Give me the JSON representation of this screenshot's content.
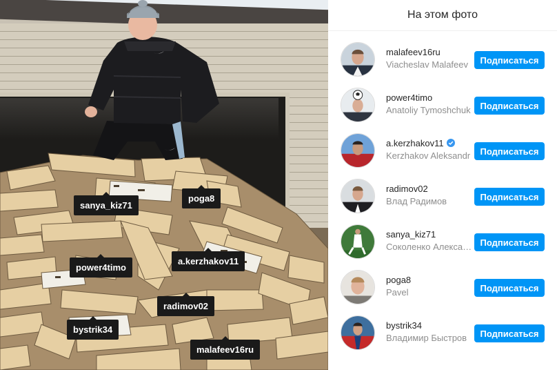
{
  "panel": {
    "title": "На этом фото",
    "accent_color": "#0095f6",
    "people": [
      {
        "username": "malafeev16ru",
        "full_name": "Viacheslav Malafeev",
        "verified": false,
        "button": "Подписаться"
      },
      {
        "username": "power4timo",
        "full_name": "Anatoliy Tymoshchuk",
        "verified": false,
        "button": "Подписаться"
      },
      {
        "username": "a.kerzhakov11",
        "full_name": "Kerzhakov Aleksandr",
        "verified": true,
        "button": "Подписаться"
      },
      {
        "username": "radimov02",
        "full_name": "Влад Радимов",
        "verified": false,
        "button": "Подписаться"
      },
      {
        "username": "sanya_kiz71",
        "full_name": "Соколенко Алекса…",
        "verified": false,
        "button": "Подписаться"
      },
      {
        "username": "poga8",
        "full_name": "Pavel",
        "verified": false,
        "button": "Подписаться"
      },
      {
        "username": "bystrik34",
        "full_name": "Владимир Быстров",
        "verified": false,
        "button": "Подписаться"
      }
    ]
  },
  "photo_tags": [
    {
      "label": "sanya_kiz71"
    },
    {
      "label": "poga8"
    },
    {
      "label": "power4timo"
    },
    {
      "label": "a.kerzhakov11"
    },
    {
      "label": "radimov02"
    },
    {
      "label": "bystrik34"
    },
    {
      "label": "malafeev16ru"
    }
  ]
}
